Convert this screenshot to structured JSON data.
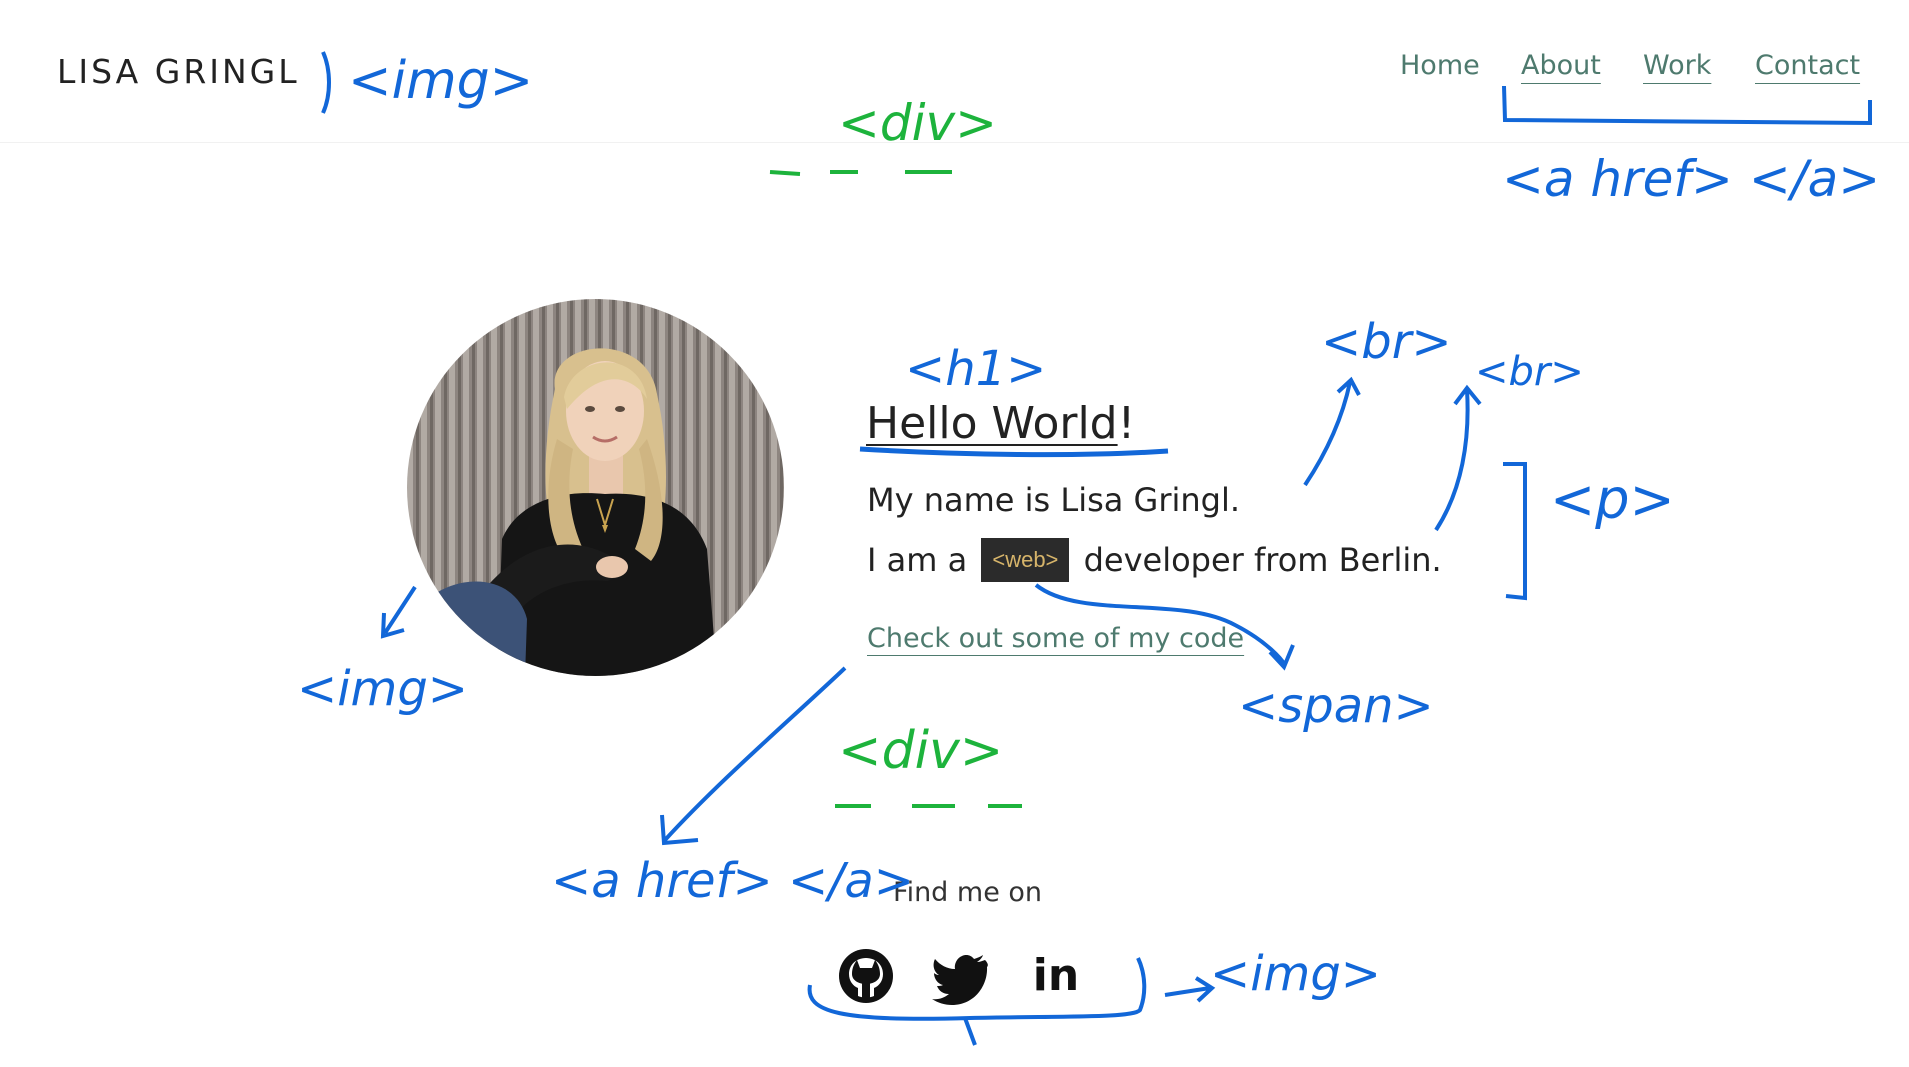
{
  "header": {
    "logo_text": "LISA GRINGL"
  },
  "nav": {
    "items": [
      {
        "label": "Home"
      },
      {
        "label": "About"
      },
      {
        "label": "Work"
      },
      {
        "label": "Contact"
      }
    ],
    "link_color": "#4e7a6e"
  },
  "hero": {
    "avatar_icon": "portrait-photo",
    "heading_main": "Hello World",
    "heading_punct": "!",
    "line1": "My name is Lisa Gringl.",
    "line2_before": "I am a",
    "line2_tag": "<web>",
    "line2_after": "developer from Berlin.",
    "code_link": "Check out some of my code"
  },
  "social": {
    "label": "Find me on",
    "icons": [
      "github-icon",
      "twitter-icon",
      "linkedin-icon"
    ],
    "linkedin_text": "in"
  },
  "annotations": {
    "color_blue": "#1267d8",
    "color_green": "#1db33c",
    "logo_img": "<img>",
    "top_div": "<div>",
    "nav_anchor": "<a href>  </a>",
    "h1": "<h1>",
    "br1": "<br>",
    "br2": "<br>",
    "p": "<p>",
    "photo_img": "<img>",
    "span": "<span>",
    "bottom_div": "<div>",
    "link_anchor": "<a href> </a>",
    "social_img": "<img>"
  }
}
